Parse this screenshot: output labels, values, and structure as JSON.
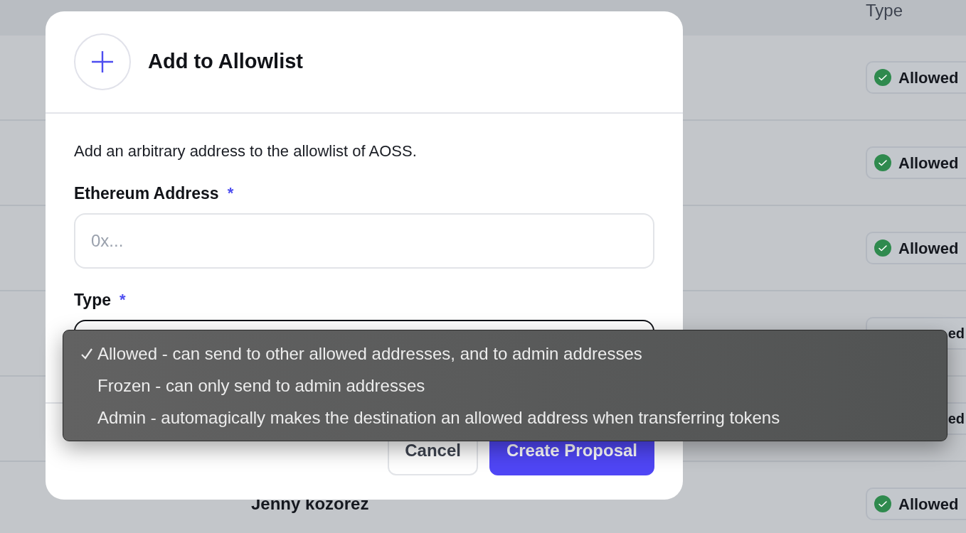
{
  "table": {
    "type_column": "Type",
    "rows": [
      {
        "type": "Allowed",
        "kind": "badge"
      },
      {
        "type": "Allowed",
        "kind": "badge"
      },
      {
        "type": "Allowed",
        "kind": "badge"
      },
      {
        "type": "ed",
        "kind": "covered"
      },
      {
        "type": "ed",
        "kind": "covered"
      },
      {
        "owner": "Jenny kozorez",
        "type": "Allowed",
        "kind": "badge"
      }
    ]
  },
  "dialog": {
    "title": "Add to Allowlist",
    "description": "Add an arbitrary address to the allowlist of AOSS.",
    "fields": [
      {
        "label": "Ethereum Address",
        "required_mark": "*",
        "kind": "text",
        "placeholder": "0x..."
      },
      {
        "label": "Type",
        "required_mark": "*",
        "kind": "select",
        "focused": true
      }
    ],
    "buttons": [
      {
        "label": "Cancel",
        "kind": "secondary"
      },
      {
        "label": "Create Proposal",
        "kind": "primary"
      }
    ]
  },
  "menu": {
    "items": [
      {
        "label": "Allowed - can send to other allowed addresses, and to admin addresses",
        "selected": true
      },
      {
        "label": "Frozen - can only send to admin addresses",
        "selected": false
      },
      {
        "label": "Admin - automagically makes the destination an allowed address when transferring tokens",
        "selected": false
      }
    ]
  }
}
